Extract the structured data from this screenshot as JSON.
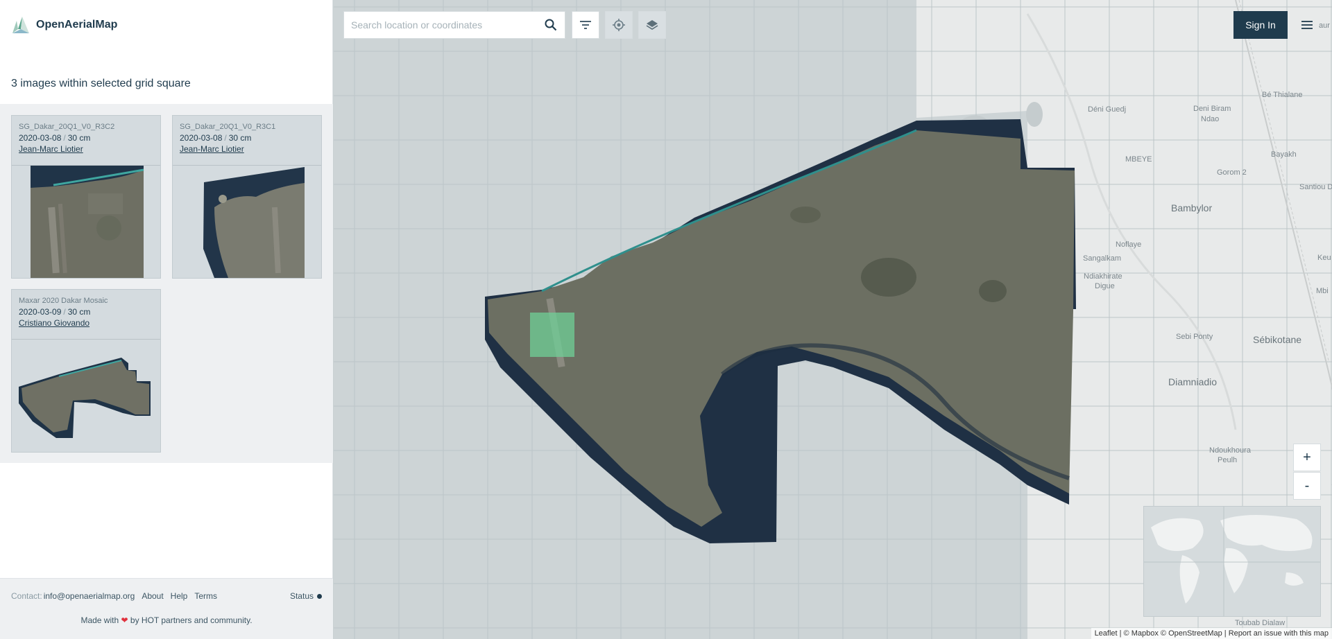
{
  "brand": {
    "name": "OpenAerialMap"
  },
  "results": {
    "title": "3 images within selected grid square",
    "items": [
      {
        "title": "SG_Dakar_20Q1_V0_R3C2",
        "date": "2020-03-08",
        "resolution": "30 cm",
        "author": "Jean-Marc Liotier"
      },
      {
        "title": "SG_Dakar_20Q1_V0_R3C1",
        "date": "2020-03-08",
        "resolution": "30 cm",
        "author": "Jean-Marc Liotier"
      },
      {
        "title": "Maxar 2020 Dakar Mosaic",
        "date": "2020-03-09",
        "resolution": "30 cm",
        "author": "Cristiano Giovando"
      }
    ],
    "separator": "/"
  },
  "footer": {
    "contact_label": "Contact:",
    "email": "info@openaerialmap.org",
    "about": "About",
    "help": "Help",
    "terms": "Terms",
    "status": "Status",
    "made_with_before": "Made with",
    "made_with_after": "by HOT partners and community."
  },
  "search": {
    "placeholder": "Search location or coordinates",
    "value": ""
  },
  "toolbar": {
    "icons": [
      "search-icon",
      "filter-icon",
      "locate-icon",
      "layers-icon"
    ],
    "signin_label": "Sign In",
    "menu_icon": "menu-icon"
  },
  "zoom": {
    "in_label": "+",
    "out_label": "-"
  },
  "attribution": "Leaflet | © Mapbox © OpenStreetMap | Report an issue with this map",
  "map_labels": {
    "deni_guedj": "Déni Guedj",
    "deni_biram": "Deni Biram",
    "ndao": "Ndao",
    "be_thialane": "Bé Thialane",
    "mbeye": "MBEYE",
    "gorom": "Gorom 2",
    "bayakh": "Bayakh",
    "santiou": "Santiou Diar",
    "bambylor": "Bambylor",
    "noflaye": "Noflaye",
    "sangalkam": "Sangalkam",
    "keu": "Keu",
    "ndiakhirate": "Ndiakhirate",
    "digue": "Digue",
    "mbi": "Mbi",
    "sebi_ponty": "Sebi Ponty",
    "sebikotane": "Sébikotane",
    "diamniadio": "Diamniadio",
    "ndoukhoura": "Ndoukhoura",
    "peulh": "Peulh",
    "toubab": "Toubab Dialaw",
    "aur": "aur"
  },
  "colors": {
    "brand_dark": "#1f3b4d",
    "selected_grid": "#6fcf97",
    "imagery": "#6b6d5e",
    "ocean": "#2a3b4f",
    "heart": "#e0323e"
  }
}
